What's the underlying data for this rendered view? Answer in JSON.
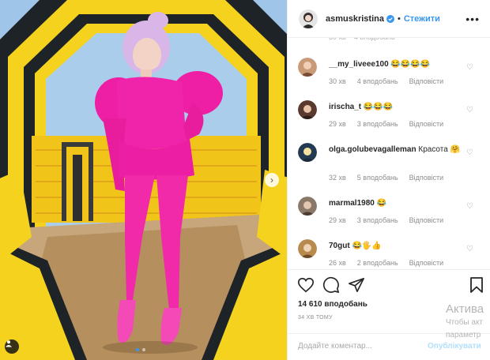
{
  "header": {
    "username": "asmuskristina",
    "separator": "•",
    "follow_label": "Стежити",
    "more_label": "•••"
  },
  "comments": [
    {
      "user": "__my_liveee100",
      "text": "😂😂😂😂",
      "time": "30 хв",
      "likes": "4 вподобань",
      "reply": "Відповісти"
    },
    {
      "user": "irischa_t",
      "text": "😂😂😂",
      "time": "29 хв",
      "likes": "3 вподобань",
      "reply": "Відповісти"
    },
    {
      "user": "olga.golubevagalleman",
      "text": "Красота 🤗",
      "time": "32 хв",
      "likes": "5 вподобань",
      "reply": "Відповісти"
    },
    {
      "user": "marmal1980",
      "text": "😂",
      "time": "29 хв",
      "likes": "3 вподобань",
      "reply": "Відповісти"
    },
    {
      "user": "70gut",
      "text": "😂🖐👍",
      "time": "26 хв",
      "likes": "2 вподобань",
      "reply": "Відповісти"
    }
  ],
  "actions": {
    "likes": "14 610 вподобань",
    "time": "34 ХВ ТОМУ",
    "add_comment_placeholder": "Додайте коментар...",
    "post_label": "Опублікувати"
  },
  "watermark": {
    "line1": "Актива",
    "line2": "Чтобы акт",
    "line3": "параметр"
  },
  "carousel": {
    "slides": 2,
    "active": 1
  },
  "colors": {
    "link_blue": "#3897f0",
    "post_disabled": "#b2dffc",
    "outfit_pink": "#f020a8",
    "frame_yellow": "#f5d21e"
  },
  "icons": {
    "like": "heart-icon",
    "comment": "comment-icon",
    "share": "share-icon",
    "save": "bookmark-icon",
    "verified": "verified-badge-icon",
    "next": "chevron-right-icon",
    "tag": "user-tag-icon"
  }
}
